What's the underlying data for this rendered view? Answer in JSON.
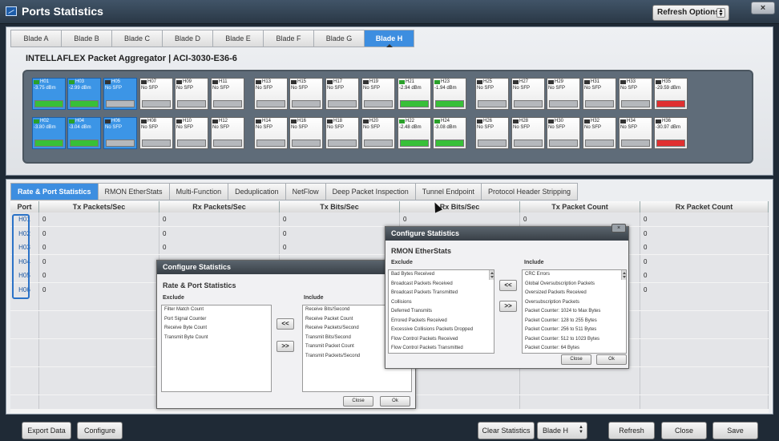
{
  "window": {
    "title": "Ports Statistics",
    "refresh_options": "Refresh Options",
    "close": "×"
  },
  "blade_tabs": [
    "Blade A",
    "Blade B",
    "Blade C",
    "Blade D",
    "Blade E",
    "Blade F",
    "Blade G",
    "Blade H"
  ],
  "active_blade": "Blade H",
  "device_title": "INTELLAFLEX Packet Aggregator  |  ACI-3030-E36-6",
  "ports_top": [
    {
      "id": "H01",
      "val": "-3.75 dBm",
      "status": "green",
      "sel": true,
      "icon": "green"
    },
    {
      "id": "H03",
      "val": "-2.99 dBm",
      "status": "green",
      "sel": true,
      "icon": "green"
    },
    {
      "id": "H05",
      "val": "No SFP",
      "status": "gray",
      "sel": true,
      "icon": "dark"
    },
    {
      "id": "H07",
      "val": "No SFP",
      "status": "gray",
      "sel": false,
      "icon": "dark"
    },
    {
      "id": "H09",
      "val": "No SFP",
      "status": "gray",
      "sel": false,
      "icon": "dark"
    },
    {
      "id": "H11",
      "val": "No SFP",
      "status": "gray",
      "sel": false,
      "icon": "dark"
    },
    {
      "id": "H13",
      "val": "No SFP",
      "status": "gray",
      "sel": false,
      "icon": "dark"
    },
    {
      "id": "H15",
      "val": "No SFP",
      "status": "gray",
      "sel": false,
      "icon": "dark"
    },
    {
      "id": "H17",
      "val": "No SFP",
      "status": "gray",
      "sel": false,
      "icon": "dark"
    },
    {
      "id": "H19",
      "val": "No SFP",
      "status": "gray",
      "sel": false,
      "icon": "dark"
    },
    {
      "id": "H21",
      "val": "-2.94 dBm",
      "status": "green",
      "sel": false,
      "icon": "green"
    },
    {
      "id": "H23",
      "val": "-1.94 dBm",
      "status": "green",
      "sel": false,
      "icon": "green"
    },
    {
      "id": "H25",
      "val": "No SFP",
      "status": "gray",
      "sel": false,
      "icon": "dark"
    },
    {
      "id": "H27",
      "val": "No SFP",
      "status": "gray",
      "sel": false,
      "icon": "dark"
    },
    {
      "id": "H29",
      "val": "No SFP",
      "status": "gray",
      "sel": false,
      "icon": "dark"
    },
    {
      "id": "H31",
      "val": "No SFP",
      "status": "gray",
      "sel": false,
      "icon": "dark"
    },
    {
      "id": "H33",
      "val": "No SFP",
      "status": "gray",
      "sel": false,
      "icon": "dark"
    },
    {
      "id": "H35",
      "val": "-29.59 dBm",
      "status": "red",
      "sel": false,
      "icon": "dark"
    }
  ],
  "ports_bottom": [
    {
      "id": "H02",
      "val": "-3.80 dBm",
      "status": "green",
      "sel": true,
      "icon": "green"
    },
    {
      "id": "H04",
      "val": "-3.04 dBm",
      "status": "green",
      "sel": true,
      "icon": "green"
    },
    {
      "id": "H06",
      "val": "No SFP",
      "status": "gray",
      "sel": true,
      "icon": "dark"
    },
    {
      "id": "H08",
      "val": "No SFP",
      "status": "gray",
      "sel": false,
      "icon": "dark"
    },
    {
      "id": "H10",
      "val": "No SFP",
      "status": "gray",
      "sel": false,
      "icon": "dark"
    },
    {
      "id": "H12",
      "val": "No SFP",
      "status": "gray",
      "sel": false,
      "icon": "dark"
    },
    {
      "id": "H14",
      "val": "No SFP",
      "status": "gray",
      "sel": false,
      "icon": "dark"
    },
    {
      "id": "H16",
      "val": "No SFP",
      "status": "gray",
      "sel": false,
      "icon": "dark"
    },
    {
      "id": "H18",
      "val": "No SFP",
      "status": "gray",
      "sel": false,
      "icon": "dark"
    },
    {
      "id": "H20",
      "val": "No SFP",
      "status": "gray",
      "sel": false,
      "icon": "dark"
    },
    {
      "id": "H22",
      "val": "-2.48 dBm",
      "status": "green",
      "sel": false,
      "icon": "green"
    },
    {
      "id": "H24",
      "val": "-3.08 dBm",
      "status": "green",
      "sel": false,
      "icon": "green"
    },
    {
      "id": "H26",
      "val": "No SFP",
      "status": "gray",
      "sel": false,
      "icon": "dark"
    },
    {
      "id": "H28",
      "val": "No SFP",
      "status": "gray",
      "sel": false,
      "icon": "dark"
    },
    {
      "id": "H30",
      "val": "No SFP",
      "status": "gray",
      "sel": false,
      "icon": "dark"
    },
    {
      "id": "H32",
      "val": "No SFP",
      "status": "gray",
      "sel": false,
      "icon": "dark"
    },
    {
      "id": "H34",
      "val": "No SFP",
      "status": "gray",
      "sel": false,
      "icon": "dark"
    },
    {
      "id": "H36",
      "val": "-30.97 dBm",
      "status": "red",
      "sel": false,
      "icon": "dark"
    }
  ],
  "stat_tabs": [
    "Rate & Port Statistics",
    "RMON EtherStats",
    "Multi-Function",
    "Deduplication",
    "NetFlow",
    "Deep Packet Inspection",
    "Tunnel Endpoint",
    "Protocol Header Stripping"
  ],
  "active_stat_tab": "Rate & Port Statistics",
  "table": {
    "headers": [
      "Port",
      "Tx Packets/Sec",
      "Rx Packets/Sec",
      "Tx Bits/Sec",
      "Rx Bits/Sec",
      "Tx Packet Count",
      "Rx Packet Count"
    ],
    "rows": [
      [
        "H01",
        "0",
        "0",
        "0",
        "0",
        "0",
        "0"
      ],
      [
        "H02",
        "0",
        "0",
        "0",
        "",
        "",
        "0"
      ],
      [
        "H03",
        "0",
        "0",
        "0",
        "",
        "",
        "0"
      ],
      [
        "H04",
        "0",
        "",
        "",
        "",
        "",
        "0"
      ],
      [
        "H05",
        "0",
        "",
        "",
        "",
        "",
        "0"
      ],
      [
        "H06",
        "0",
        "",
        "",
        "",
        "",
        "0"
      ]
    ],
    "empty_rows": 8
  },
  "dialog_rate": {
    "title": "Configure Statistics",
    "subtitle": "Rate & Port Statistics",
    "exclude_label": "Exclude",
    "include_label": "Include",
    "exclude": [
      "Filter Match Count",
      "Port Signal Counter",
      "Receive Byte Count",
      "Transmit Byte Count"
    ],
    "include": [
      "Receive Bits/Second",
      "Receive Packet Count",
      "Receive Packets/Second",
      "Transmit Bits/Second",
      "Transmit Packet Count",
      "Transmit Packets/Second"
    ],
    "move_left": "<<",
    "move_right": ">>",
    "close": "Close",
    "ok": "Ok"
  },
  "dialog_rmon": {
    "title": "Configure Statistics",
    "subtitle": "RMON EtherStats",
    "exclude_label": "Exclude",
    "include_label": "Include",
    "exclude": [
      "Bad Bytes Received",
      "Broadcast Packets Received",
      "Broadcast Packets Transmitted",
      "Collisions",
      "Deferred Transmits",
      "Errored Packets Received",
      "Excessive Collisions Packets Dropped",
      "Flow Control Packets Received",
      "Flow Control Packets Transmitted"
    ],
    "include": [
      "CRC Errors",
      "Global Oversubscription Packets",
      "Oversized Packets Received",
      "Oversubscription Packets",
      "Packet Counter: 1024 to Max Bytes",
      "Packet Counter: 128 to 255 Bytes",
      "Packet Counter: 256 to 511 Bytes",
      "Packet Counter: 512 to 1023 Bytes",
      "Packet Counter: 64 Bytes"
    ],
    "move_left": "<<",
    "move_right": ">>",
    "close": "Close",
    "ok": "Ok",
    "x": "×"
  },
  "bottom_buttons": {
    "export": "Export Data",
    "configure": "Configure",
    "clear": "Clear Statistics",
    "blade_select": "Blade H",
    "refresh": "Refresh",
    "close": "Close",
    "save": "Save"
  }
}
